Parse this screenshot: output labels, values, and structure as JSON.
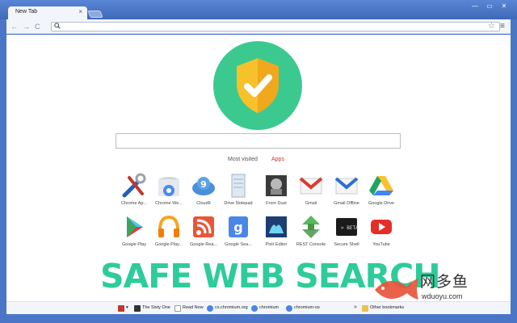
{
  "tab": {
    "title": "New Tab",
    "close_glyph": "×"
  },
  "window_controls": [
    "—",
    "▭",
    "✕"
  ],
  "toolbar": {
    "back": "←",
    "forward": "→",
    "reload": "C",
    "search_icon": "search-icon",
    "omnibox_value": "",
    "star": "☆",
    "menu": "≡"
  },
  "search_box": {
    "value": ""
  },
  "pager": {
    "most_visited": "Most visited",
    "apps": "Apps"
  },
  "apps": [
    {
      "label": "Chrome Ap...",
      "icon": "chrome-app-launcher-icon"
    },
    {
      "label": "Chrome We...",
      "icon": "chrome-web-store-icon"
    },
    {
      "label": "Cloud9",
      "icon": "cloud9-icon"
    },
    {
      "label": "Drive Notepad",
      "icon": "notepad-icon"
    },
    {
      "label": "From Dust",
      "icon": "from-dust-icon"
    },
    {
      "label": "Gmail",
      "icon": "gmail-icon"
    },
    {
      "label": "Gmail Offline",
      "icon": "gmail-offline-icon"
    },
    {
      "label": "Google Drive",
      "icon": "google-drive-icon"
    },
    {
      "label": "Google Play",
      "icon": "google-play-icon"
    },
    {
      "label": "Google Play...",
      "icon": "google-play-music-icon"
    },
    {
      "label": "Google Rea...",
      "icon": "google-reader-icon"
    },
    {
      "label": "Google Sea...",
      "icon": "google-search-icon"
    },
    {
      "label": "Pixlr Editor",
      "icon": "pixlr-icon"
    },
    {
      "label": "REST Console",
      "icon": "rest-console-icon"
    },
    {
      "label": "Secure Shell",
      "icon": "secure-shell-icon"
    },
    {
      "label": "YouTube",
      "icon": "youtube-icon"
    }
  ],
  "promo_text": "SAFE WEB SEARCH",
  "bookmarks": [
    {
      "label": "",
      "icon": "bookmark-app-icon"
    },
    {
      "label": "The Sixty One",
      "icon": "sixty-one-icon"
    },
    {
      "label": "Read Now",
      "icon": "page-icon"
    },
    {
      "label": "cs.chromium.org",
      "icon": "chromium-icon"
    },
    {
      "label": "chromium",
      "icon": "chromium-icon"
    },
    {
      "label": "chromium-os",
      "icon": "chromium-icon"
    }
  ],
  "bookmarks_overflow": "»",
  "other_bookmarks": "Other bookmarks",
  "watermark": {
    "text": "网多鱼",
    "url": "wduoyu.com"
  },
  "colors": {
    "frame": "#4b76c7",
    "shield": "#f7c12b",
    "circle": "#3cc98f",
    "promo": "#2ecb9b",
    "apps_link": "#c0392b"
  }
}
